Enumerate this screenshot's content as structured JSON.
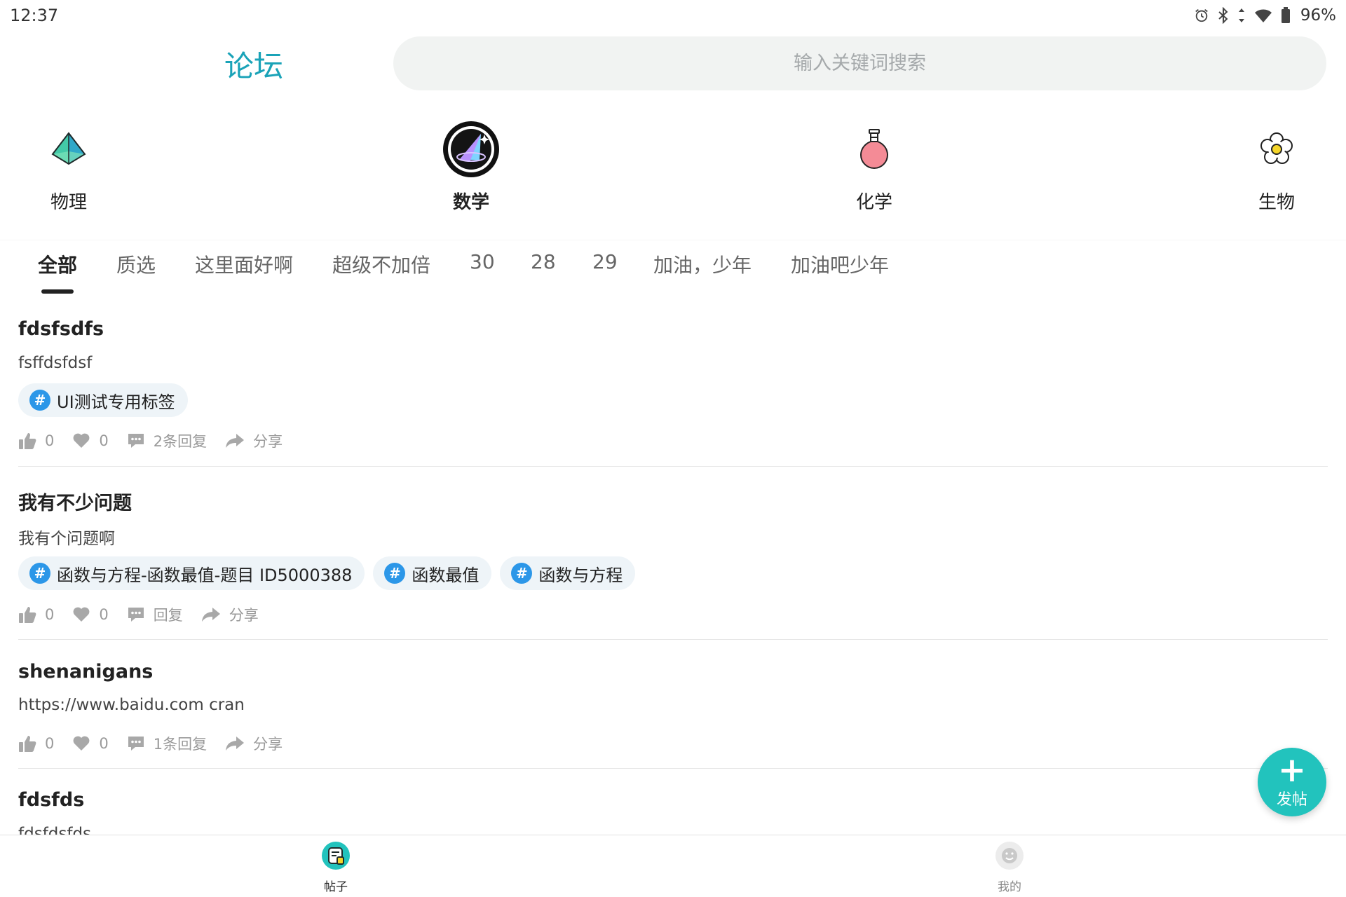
{
  "status_bar": {
    "time": "12:37",
    "battery": "96%",
    "icons": [
      "alarm-icon",
      "bluetooth-icon",
      "data-arrows-icon",
      "wifi-icon",
      "battery-icon"
    ]
  },
  "header": {
    "title": "论坛",
    "search_placeholder": "输入关键词搜索"
  },
  "subjects": [
    {
      "label": "物理",
      "icon": "pyramid-icon",
      "active": false
    },
    {
      "label": "数学",
      "icon": "math-cone-icon",
      "active": true
    },
    {
      "label": "化学",
      "icon": "flask-icon",
      "active": false
    },
    {
      "label": "生物",
      "icon": "flower-icon",
      "active": false
    }
  ],
  "tabs": [
    "全部",
    "质选",
    "这里面好啊",
    "超级不加倍",
    "30",
    "28",
    "29",
    "加油，少年",
    "加油吧少年"
  ],
  "active_tab": "全部",
  "posts": [
    {
      "title": "fdsfsdfs",
      "body": "fsffdsfdsf",
      "tags": [
        "UI测试专用标签"
      ],
      "likes": "0",
      "favorites": "0",
      "replies": "2条回复",
      "share": "分享"
    },
    {
      "title": "我有不少问题",
      "body": "我有个问题啊",
      "tags": [
        "函数与方程-函数最值-题目 ID5000388",
        "函数最值",
        "函数与方程"
      ],
      "likes": "0",
      "favorites": "0",
      "replies": "回复",
      "share": "分享"
    },
    {
      "title": "shenanigans",
      "body": "https://www.baidu.com cran",
      "tags": [],
      "likes": "0",
      "favorites": "0",
      "replies": "1条回复",
      "share": "分享"
    },
    {
      "title": "fdsfds",
      "body": "fdsfdsfds",
      "tags": [],
      "likes": "",
      "favorites": "",
      "replies": "",
      "share": ""
    }
  ],
  "fab": {
    "label": "发帖"
  },
  "bottom_nav": [
    {
      "label": "帖子",
      "icon": "posts-icon",
      "active": true
    },
    {
      "label": "我的",
      "icon": "profile-icon",
      "active": false
    }
  ],
  "colors": {
    "accent": "#1aa3b8",
    "fab": "#22c3bd",
    "tag_hash": "#2c97e8",
    "tag_bg": "#eef4f8",
    "search_bg": "#f1f3f2"
  }
}
